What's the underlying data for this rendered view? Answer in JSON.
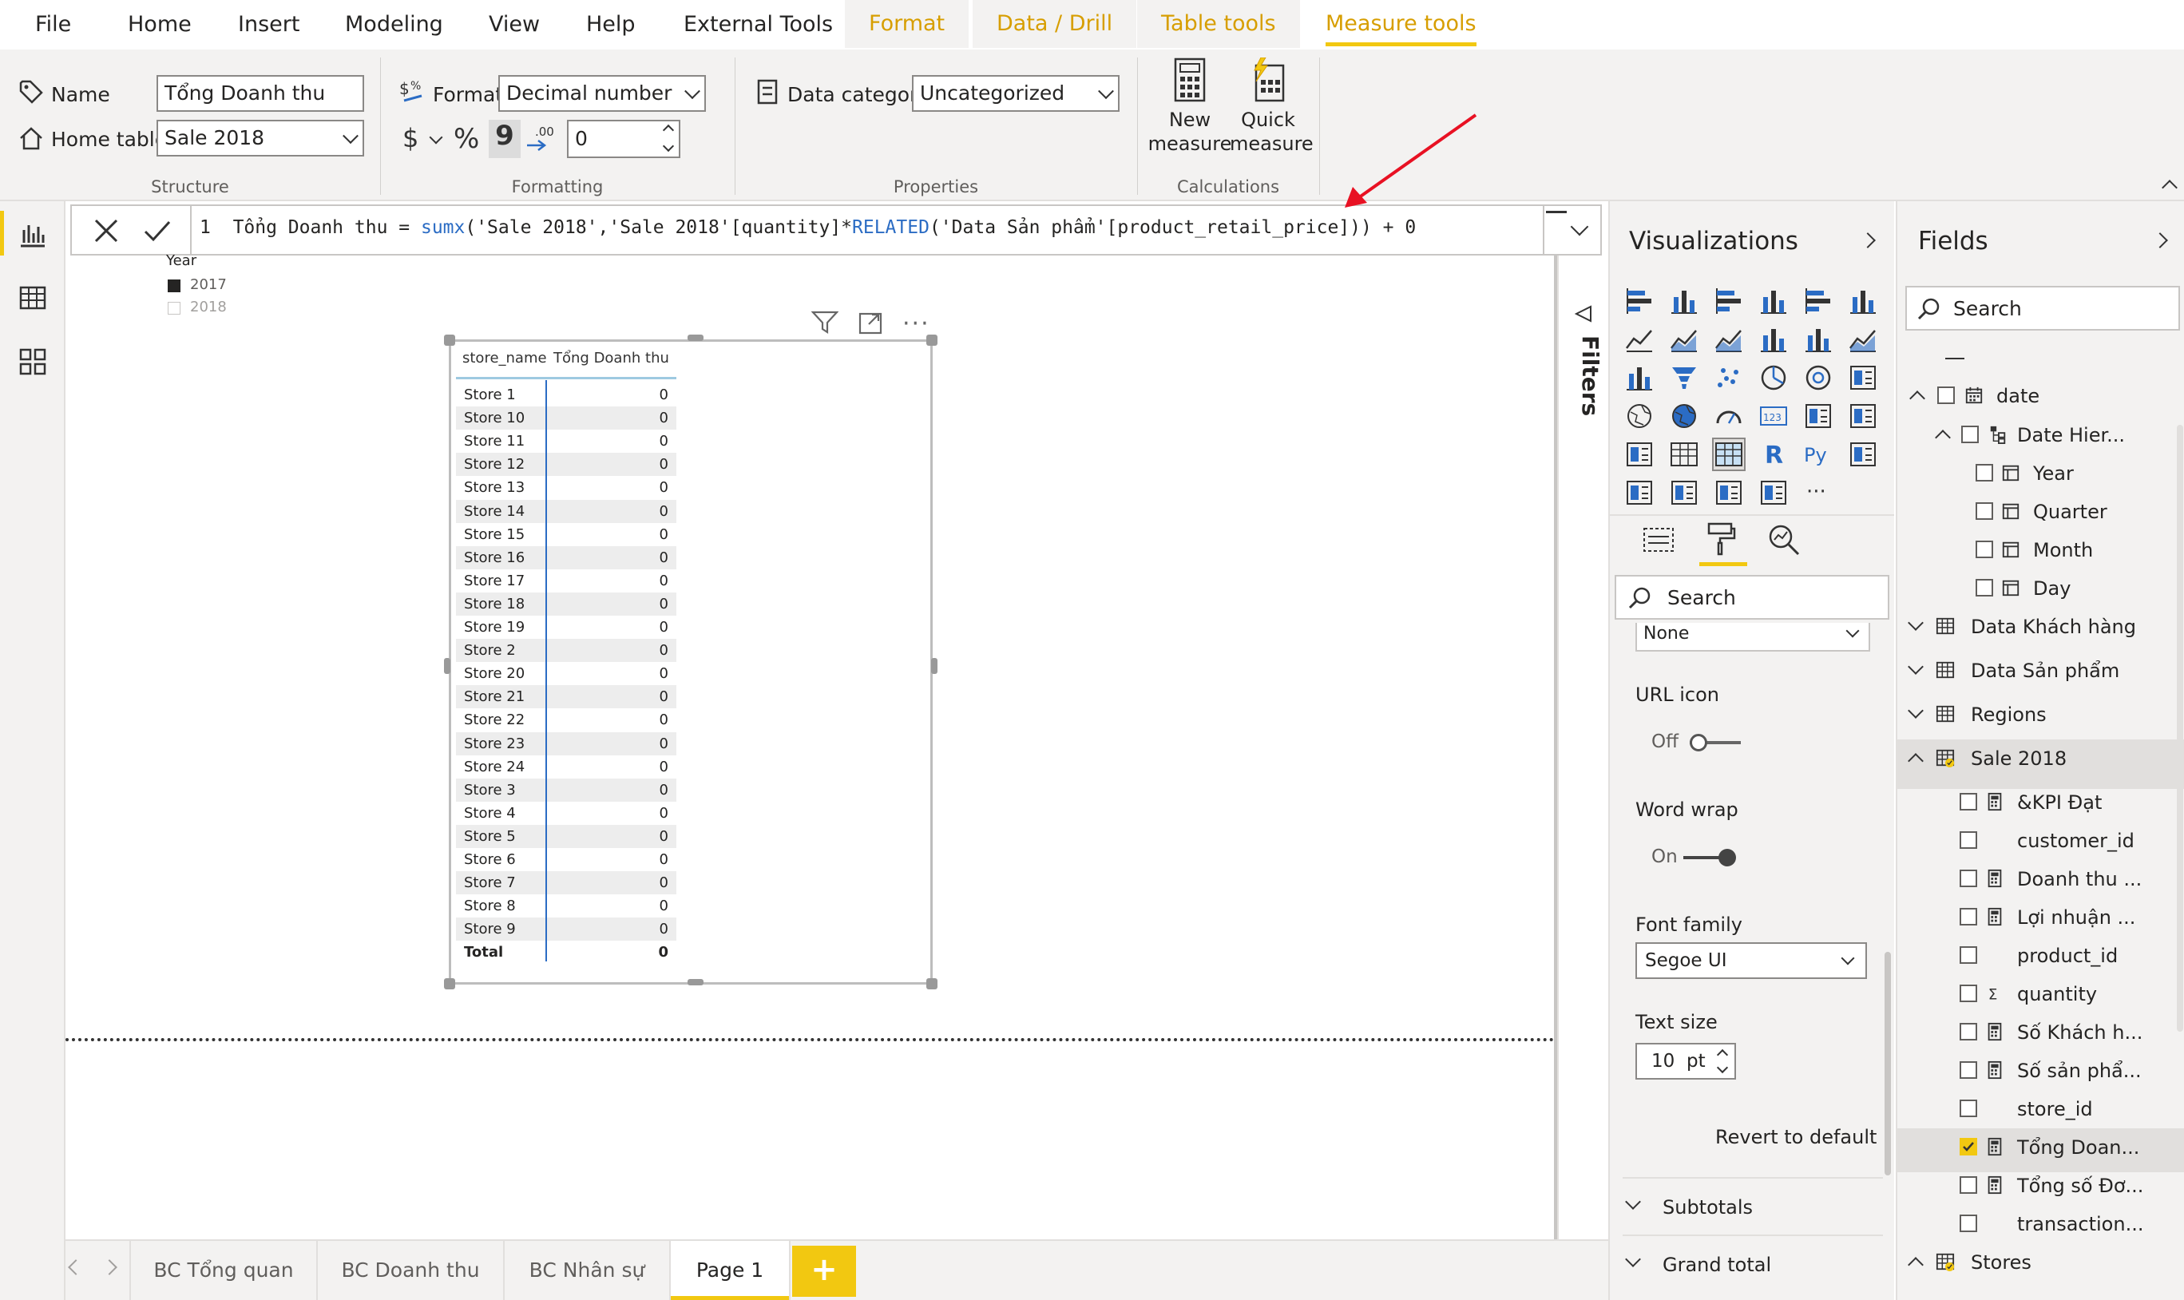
{
  "menu": {
    "file": "File",
    "items": [
      "Home",
      "Insert",
      "Modeling",
      "View",
      "Help",
      "External Tools"
    ],
    "context_tabs": [
      "Format",
      "Data / Drill",
      "Table tools",
      "Measure tools"
    ],
    "active_tab": "Measure tools"
  },
  "ribbon": {
    "structure": {
      "name_label": "Name",
      "name_value": "Tổng Doanh thu",
      "home_table_label": "Home table",
      "home_table_value": "Sale 2018",
      "group": "Structure"
    },
    "formatting": {
      "format_label": "Format",
      "format_value": "Decimal number",
      "currency": "$",
      "percent": "%",
      "comma": "9",
      "decimals": "0",
      "group": "Formatting"
    },
    "properties": {
      "data_category_label": "Data category",
      "data_category_value": "Uncategorized",
      "group": "Properties"
    },
    "calculations": {
      "new_measure": [
        "New",
        "measure"
      ],
      "quick_measure": [
        "Quick",
        "measure"
      ],
      "group": "Calculations"
    }
  },
  "formula": {
    "line_no": "1",
    "text_prefix": "Tổng Doanh thu = ",
    "fn1": "sumx",
    "text_mid": "('Sale 2018','Sale 2018'[quantity]*",
    "fn2": "RELATED",
    "text_end": "('Data Sản phẩm'[product_retail_price])) + 0"
  },
  "legend": {
    "title": "Year",
    "items": [
      "2017",
      "2018"
    ],
    "colors": [
      "#252423",
      "#ffffff"
    ]
  },
  "table": {
    "headers": [
      "store_name",
      "Tổng Doanh thu"
    ],
    "rows": [
      [
        "Store 1",
        "0"
      ],
      [
        "Store 10",
        "0"
      ],
      [
        "Store 11",
        "0"
      ],
      [
        "Store 12",
        "0"
      ],
      [
        "Store 13",
        "0"
      ],
      [
        "Store 14",
        "0"
      ],
      [
        "Store 15",
        "0"
      ],
      [
        "Store 16",
        "0"
      ],
      [
        "Store 17",
        "0"
      ],
      [
        "Store 18",
        "0"
      ],
      [
        "Store 19",
        "0"
      ],
      [
        "Store 2",
        "0"
      ],
      [
        "Store 20",
        "0"
      ],
      [
        "Store 21",
        "0"
      ],
      [
        "Store 22",
        "0"
      ],
      [
        "Store 23",
        "0"
      ],
      [
        "Store 24",
        "0"
      ],
      [
        "Store 3",
        "0"
      ],
      [
        "Store 4",
        "0"
      ],
      [
        "Store 5",
        "0"
      ],
      [
        "Store 6",
        "0"
      ],
      [
        "Store 7",
        "0"
      ],
      [
        "Store 8",
        "0"
      ],
      [
        "Store 9",
        "0"
      ]
    ],
    "total": [
      "Total",
      "0"
    ]
  },
  "filters": {
    "label": "Filters"
  },
  "visualizations": {
    "title": "Visualizations",
    "search_placeholder": "Search",
    "dropdown_value": "None",
    "url_icon_label": "URL icon",
    "url_icon_state": "Off",
    "word_wrap_label": "Word wrap",
    "word_wrap_state": "On",
    "font_family_label": "Font family",
    "font_family_value": "Segoe UI",
    "text_size_label": "Text size",
    "text_size_value": "10",
    "text_size_unit": "pt",
    "revert": "Revert to default",
    "subtotals": "Subtotals",
    "grand_total": "Grand total",
    "r_label": "R",
    "py_label": "Py",
    "num_label": "123"
  },
  "fields": {
    "title": "Fields",
    "search_placeholder": "Search",
    "items": [
      {
        "label": "date",
        "level": 0,
        "type": "calendar",
        "expanded": true,
        "checkbox": true
      },
      {
        "label": "Date Hier...",
        "level": 1,
        "type": "hierarchy",
        "expanded": true,
        "checkbox": true
      },
      {
        "label": "Year",
        "level": 2,
        "type": "datepart",
        "checkbox": true
      },
      {
        "label": "Quarter",
        "level": 2,
        "type": "datepart",
        "checkbox": true
      },
      {
        "label": "Month",
        "level": 2,
        "type": "datepart",
        "checkbox": true
      },
      {
        "label": "Day",
        "level": 2,
        "type": "datepart",
        "checkbox": true
      },
      {
        "label": "Data Khách hàng",
        "level": -1,
        "type": "table",
        "expanded": false
      },
      {
        "label": "Data Sản phẩm",
        "level": -1,
        "type": "table",
        "expanded": false
      },
      {
        "label": "Regions",
        "level": -1,
        "type": "table",
        "expanded": false
      },
      {
        "label": "Sale 2018",
        "level": -1,
        "type": "table",
        "expanded": true,
        "selected": true
      },
      {
        "label": "&KPI Đạt",
        "level": 3,
        "type": "measure"
      },
      {
        "label": "customer_id",
        "level": 3,
        "type": "none"
      },
      {
        "label": "Doanh thu ...",
        "level": 3,
        "type": "measure"
      },
      {
        "label": "Lợi nhuận ...",
        "level": 3,
        "type": "measure"
      },
      {
        "label": "product_id",
        "level": 3,
        "type": "none"
      },
      {
        "label": "quantity",
        "level": 3,
        "type": "sigma"
      },
      {
        "label": "Số Khách h...",
        "level": 3,
        "type": "measure"
      },
      {
        "label": "Số sản phẩ...",
        "level": 3,
        "type": "measure"
      },
      {
        "label": "store_id",
        "level": 3,
        "type": "none"
      },
      {
        "label": "Tổng Doan...",
        "level": 3,
        "type": "measure",
        "checked": true,
        "selected": true
      },
      {
        "label": "Tổng số Đơ...",
        "level": 3,
        "type": "measure"
      },
      {
        "label": "transaction...",
        "level": 3,
        "type": "none"
      },
      {
        "label": "Stores",
        "level": -1,
        "type": "table",
        "expanded": true
      }
    ]
  },
  "pages": {
    "tabs": [
      "BC Tổng quan",
      "BC Doanh thu",
      "BC Nhân sự",
      "Page 1"
    ],
    "active": "Page 1",
    "add": "+"
  },
  "colors": {
    "accent": "#f2c811",
    "context_tab": "#d79e00",
    "dax_function": "#2b6cc4",
    "arrow": "#e81123"
  }
}
